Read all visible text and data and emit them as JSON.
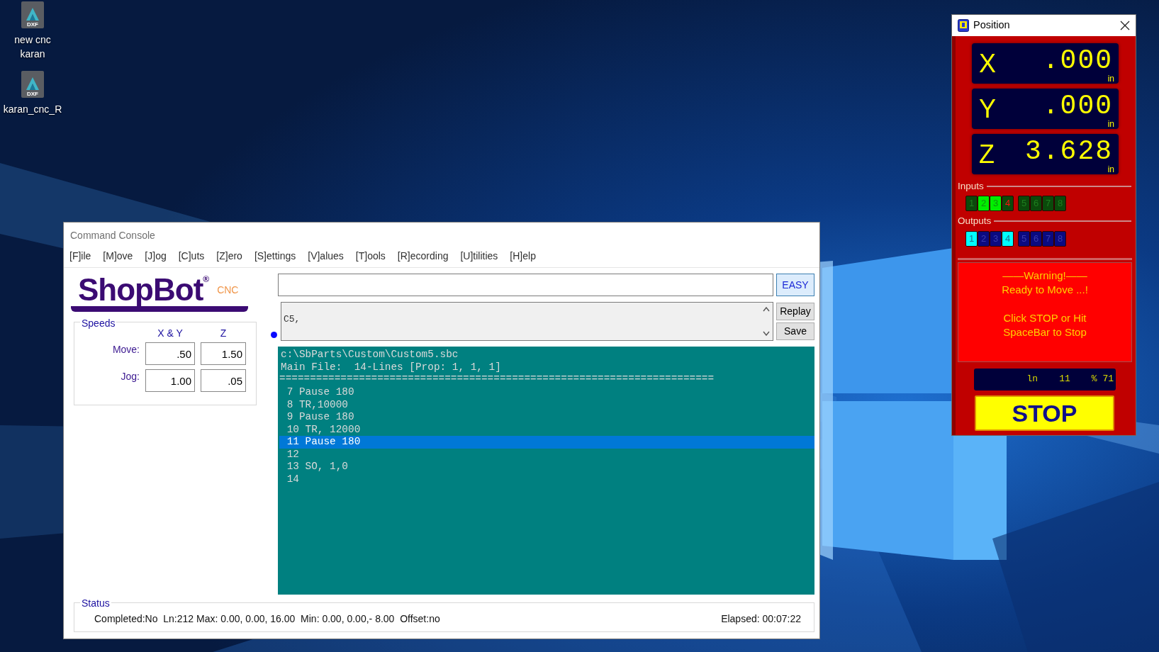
{
  "desktop_icons": [
    {
      "label": "new cnc\nkaran",
      "type_label": "DXF"
    },
    {
      "label": "karan_cnc_R",
      "type_label": "DXF"
    }
  ],
  "command_console": {
    "title": "Command Console",
    "menu": [
      "[F]ile",
      "[M]ove",
      "[J]og",
      "[C]uts",
      "[Z]ero",
      "[S]ettings",
      "[V]alues",
      "[T]ools",
      "[R]ecording",
      "[U]tilities",
      "[H]elp"
    ],
    "logo": {
      "name": "ShopBot$^{®}$",
      "suffix": "CNC"
    },
    "speeds": {
      "title": "Speeds",
      "columns": [
        "X & Y",
        "Z"
      ],
      "rows": [
        {
          "label": "Move:",
          "values": [
            ".50",
            "1.50"
          ]
        },
        {
          "label": "Jog:",
          "values": [
            "1.00",
            ".05"
          ]
        }
      ]
    },
    "easy_button": "EASY",
    "history": [
      "C5,"
    ],
    "history_buttons": [
      "Replay",
      "Save"
    ],
    "file_view": {
      "header": [
        "c:\\SbParts\\Custom\\Custom5.sbc",
        "Main File:  14-Lines [Prop: 1, 1, 1]",
        "======================================================================="
      ],
      "lines": [
        {
          "text": " 7 Pause 180",
          "selected": false
        },
        {
          "text": " 8 TR,10000",
          "selected": false
        },
        {
          "text": " 9 Pause 180",
          "selected": false
        },
        {
          "text": " 10 TR, 12000",
          "selected": false
        },
        {
          "text": " 11 Pause 180",
          "selected": true
        },
        {
          "text": " 12",
          "selected": false
        },
        {
          "text": " 13 SO, 1,0",
          "selected": false
        },
        {
          "text": " 14",
          "selected": false
        }
      ]
    },
    "status": {
      "title": "Status",
      "text": "Completed:No  Ln:212 Max: 0.00, 0.00, 16.00  Min: 0.00, 0.00,- 8.00  Offset:no",
      "elapsed": "Elapsed: 00:07:22"
    }
  },
  "position": {
    "title": "Position",
    "axes": [
      {
        "axis": "X",
        "value": ".000",
        "unit": "in"
      },
      {
        "axis": "Y",
        "value": ".000",
        "unit": "in"
      },
      {
        "axis": "Z",
        "value": "3.628",
        "unit": "in"
      }
    ],
    "inputs": {
      "label": "Inputs",
      "leds": [
        {
          "label": "1",
          "on": false,
          "alert": false
        },
        {
          "label": "2",
          "on": true,
          "alert": false
        },
        {
          "label": "3",
          "on": true,
          "alert": false
        },
        {
          "label": "4",
          "on": false,
          "alert": true
        },
        {
          "label": "5",
          "on": false,
          "alert": false
        },
        {
          "label": "6",
          "on": false,
          "alert": false
        },
        {
          "label": "7",
          "on": false,
          "alert": false
        },
        {
          "label": "8",
          "on": false,
          "alert": false
        }
      ]
    },
    "outputs": {
      "label": "Outputs",
      "leds": [
        {
          "label": "1",
          "on": true
        },
        {
          "label": "2",
          "on": false
        },
        {
          "label": "3",
          "on": false
        },
        {
          "label": "4",
          "on": true
        },
        {
          "label": "5",
          "on": false
        },
        {
          "label": "6",
          "on": false
        },
        {
          "label": "7",
          "on": false
        },
        {
          "label": "8",
          "on": false
        }
      ]
    },
    "warning": [
      "——Warning!——\nReady to Move ...!",
      "Click STOP or Hit\nSpaceBar to Stop"
    ],
    "readout": [
      "ln",
      "11",
      "% 71"
    ],
    "stop_button": "STOP"
  }
}
